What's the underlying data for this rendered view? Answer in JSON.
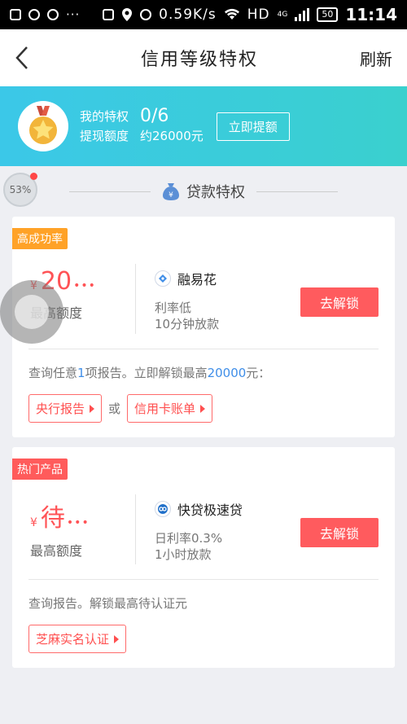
{
  "status_bar": {
    "network_speed": "0.59K/s",
    "network_type": "HD",
    "signal_label": "4G",
    "battery": "50",
    "time": "11:14"
  },
  "nav": {
    "title": "信用等级特权",
    "right_label": "刷新"
  },
  "banner": {
    "privilege_label": "我的特权",
    "privilege_value": "0/6",
    "limit_label": "提现额度",
    "limit_value": "约26000元",
    "button_label": "立即提额"
  },
  "progress_badge": "53%",
  "section": {
    "title": "贷款特权"
  },
  "cards": [
    {
      "tag": "高成功率",
      "currency": "¥",
      "amount": "20",
      "amount_suffix": "•••",
      "amount_label": "最高额度",
      "product_name": "融易花",
      "desc_line1": "利率低",
      "desc_line2": "10分钟放款",
      "unlock_label": "去解锁",
      "hint_prefix": "查询任意",
      "hint_count": "1",
      "hint_middle": "项报告。立即解锁最高",
      "hint_amount": "20000",
      "hint_suffix": "元：",
      "link1": "央行报告",
      "or_text": "或",
      "link2": "信用卡账单"
    },
    {
      "tag": "热门产品",
      "currency": "¥",
      "amount": "待",
      "amount_suffix": "•••",
      "amount_label": "最高额度",
      "product_name": "快贷极速贷",
      "desc_line1": "日利率0.3%",
      "desc_line2": "1小时放款",
      "unlock_label": "去解锁",
      "hint_text": "查询报告。解锁最高待认证元",
      "link1": "芝麻实名认证"
    }
  ],
  "colors": {
    "banner_start": "#3bc8e8",
    "banner_end": "#3ad0ce",
    "accent_red": "#ff5b5e",
    "tag_orange": "#ffa227",
    "tag_red": "#ff5b5b",
    "link_blue": "#3f8ee8"
  }
}
